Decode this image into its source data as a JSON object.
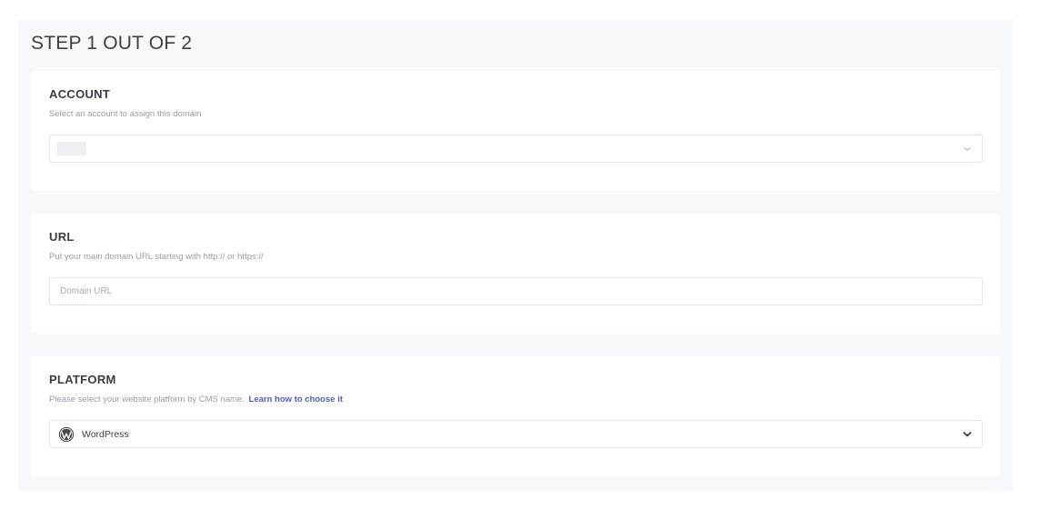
{
  "step": {
    "title": "STEP 1 OUT OF 2"
  },
  "account": {
    "title": "ACCOUNT",
    "description": "Select an account to assign this domain"
  },
  "url": {
    "title": "URL",
    "description": "Put your main domain URL starting with http:// or https://",
    "placeholder": "Domain URL"
  },
  "platform": {
    "title": "PLATFORM",
    "description": "Please select your website platform by CMS name.",
    "link_text": "Learn how to choose it",
    "selected": "WordPress",
    "icon": "wordpress-icon"
  },
  "colors": {
    "link": "#4f5bc2",
    "panel_bg": "#f7f8fb",
    "border": "#e3e5ea"
  }
}
